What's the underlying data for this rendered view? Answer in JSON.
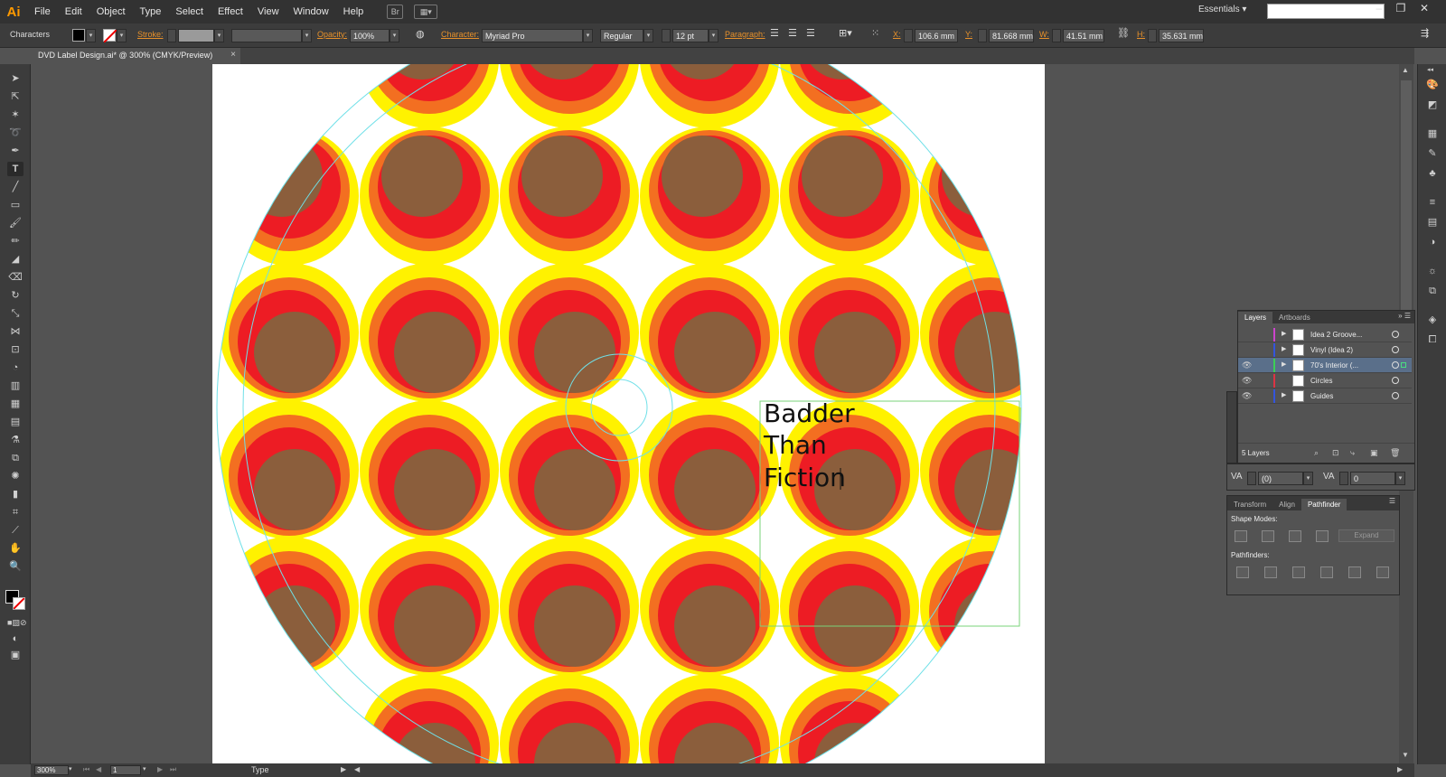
{
  "app": {
    "logo": "Ai",
    "menus": [
      "File",
      "Edit",
      "Object",
      "Type",
      "Select",
      "Effect",
      "View",
      "Window",
      "Help"
    ],
    "bridge_label": "Br",
    "workspace": "Essentials",
    "window_controls": [
      "–",
      "❐",
      "✕"
    ]
  },
  "control_bar": {
    "selection_label": "Characters",
    "stroke_label": "Stroke:",
    "opacity_label": "Opacity:",
    "opacity_value": "100%",
    "character_label": "Character:",
    "font_family": "Myriad Pro",
    "font_style": "Regular",
    "font_size": "12 pt",
    "paragraph_label": "Paragraph:",
    "x_label": "X:",
    "x_value": "106.6 mm",
    "y_label": "Y:",
    "y_value": "81.668 mm",
    "w_label": "W:",
    "w_value": "41.51 mm",
    "h_label": "H:",
    "h_value": "35.631 mm"
  },
  "document": {
    "tab_title": "DVD Label Design.ai* @ 300% (CMYK/Preview)",
    "text_lines": [
      "Badder",
      "Than",
      "Fiction"
    ]
  },
  "colors": {
    "yellow": "#fff200",
    "orange": "#f36f21",
    "red": "#ed1c24",
    "brown": "#8b5e3c",
    "guide": "#6fe0e8",
    "bbox": "#7ad37a"
  },
  "layers_panel": {
    "tabs": [
      "Layers",
      "Artboards"
    ],
    "layers": [
      {
        "name": "Idea 2 Groove...",
        "color": "#cc44cc",
        "visible": false,
        "expandable": true,
        "selected": false
      },
      {
        "name": "Vinyl (Idea 2)",
        "color": "#3355dd",
        "visible": false,
        "expandable": true,
        "selected": false
      },
      {
        "name": "70's Interior (...",
        "color": "#3ccf55",
        "visible": true,
        "expandable": true,
        "selected": true
      },
      {
        "name": "Circles",
        "color": "#dd3344",
        "visible": true,
        "expandable": false,
        "selected": false
      },
      {
        "name": "Guides",
        "color": "#3355dd",
        "visible": true,
        "expandable": true,
        "selected": false
      }
    ],
    "footer": "5 Layers"
  },
  "character_mini": {
    "kerning_value": "(0)",
    "tracking_value": "0"
  },
  "pathfinder_panel": {
    "tabs": [
      "Transform",
      "Align",
      "Pathfinder"
    ],
    "shape_modes_label": "Shape Modes:",
    "expand_label": "Expand",
    "pathfinders_label": "Pathfinders:"
  },
  "status": {
    "zoom": "300%",
    "artboard_number": "1",
    "current_tool": "Type"
  }
}
